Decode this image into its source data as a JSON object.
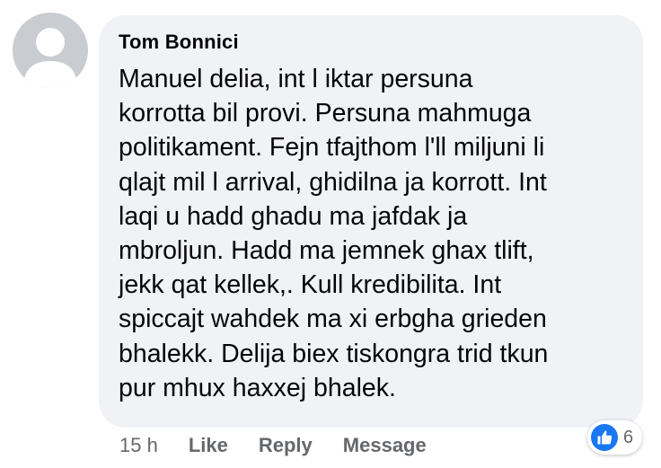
{
  "comment": {
    "author": "Tom Bonnici",
    "text": "Manuel delia, int l iktar persuna\nkorrotta bil provi. Persuna mahmuga\npolitikament.  Fejn tfajthom l'll miljuni li\nqlajt mil l arrival, ghidilna ja korrott.  Int\nlaqi u hadd ghadu ma jafdak ja\nmbroljun. Hadd ma jemnek ghax tlift,\njekk qat kellek,. Kull kredibilita. Int\nspiccajt wahdek ma xi erbgha grieden\nbhalekk.  Delija biex tiskongra trid tkun\npur mhux haxxej bhalek.",
    "time": "15 h",
    "actions": {
      "like": "Like",
      "reply": "Reply",
      "message": "Message"
    },
    "reactions": {
      "icon": "like-thumb-icon",
      "count": "6",
      "color": "#1877f2"
    }
  },
  "colors": {
    "bubble": "#f0f2f5",
    "text": "#050505",
    "muted": "#65676b",
    "avatar": "#c9ccd1"
  }
}
